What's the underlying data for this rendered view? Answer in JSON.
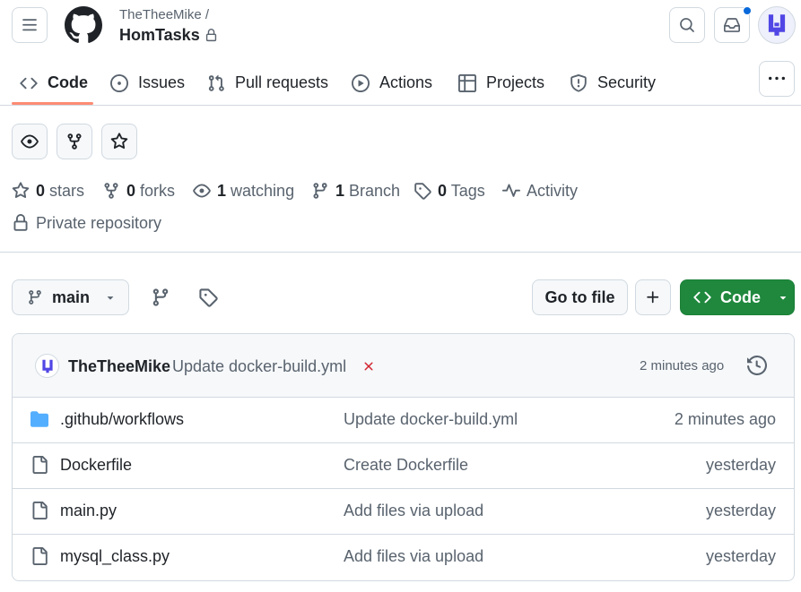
{
  "header": {
    "owner": "TheTheeMike /",
    "repo_name": "HomTasks"
  },
  "tabs": [
    {
      "label": "Code",
      "icon": "code-icon",
      "active": true
    },
    {
      "label": "Issues",
      "icon": "issue-opened-icon"
    },
    {
      "label": "Pull requests",
      "icon": "git-pull-request-icon"
    },
    {
      "label": "Actions",
      "icon": "play-icon"
    },
    {
      "label": "Projects",
      "icon": "table-icon"
    },
    {
      "label": "Security",
      "icon": "shield-icon"
    }
  ],
  "stats": {
    "stars_count": "0",
    "stars_label": "stars",
    "forks_count": "0",
    "forks_label": "forks",
    "watching_count": "1",
    "watching_label": "watching",
    "branch_count": "1",
    "branch_label": "Branch",
    "tags_count": "0",
    "tags_label": "Tags",
    "activity_label": "Activity",
    "visibility": "Private repository"
  },
  "branch_bar": {
    "branch": "main",
    "goto_file": "Go to file",
    "code_button": "Code"
  },
  "latest_commit": {
    "author": "TheTheeMike",
    "message": "Update docker-build.yml",
    "status": "failed",
    "time": "2 minutes ago"
  },
  "files": [
    {
      "name": ".github/workflows",
      "type": "folder",
      "message": "Update docker-build.yml",
      "date": "2 minutes ago"
    },
    {
      "name": "Dockerfile",
      "type": "file",
      "message": "Create Dockerfile",
      "date": "yesterday"
    },
    {
      "name": "main.py",
      "type": "file",
      "message": "Add files via upload",
      "date": "yesterday"
    },
    {
      "name": "mysql_class.py",
      "type": "file",
      "message": "Add files via upload",
      "date": "yesterday"
    }
  ],
  "colors": {
    "accent_underline": "#fd8c73",
    "code_button": "#1f883d",
    "fail_x": "#d1242f",
    "folder": "#54aeff",
    "notification_dot": "#0969da",
    "avatar": "#5046e5"
  }
}
